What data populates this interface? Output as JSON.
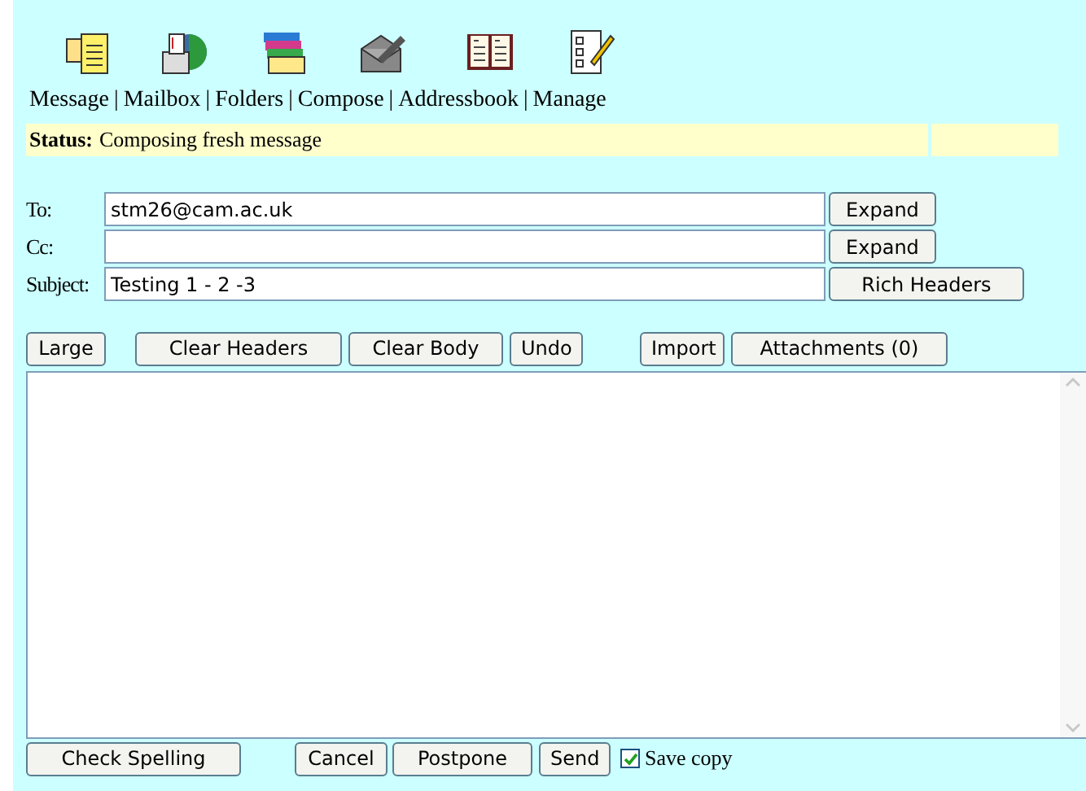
{
  "nav": [
    {
      "label": "Message",
      "kind": "message"
    },
    {
      "label": "Mailbox",
      "kind": "mailbox"
    },
    {
      "label": "Folders",
      "kind": "folders"
    },
    {
      "label": "Compose",
      "kind": "compose"
    },
    {
      "label": "Addressbook",
      "kind": "book"
    },
    {
      "label": "Manage",
      "kind": "checklist"
    }
  ],
  "separators": [
    "|",
    "|",
    "|",
    "|",
    "|"
  ],
  "status": {
    "label": "Status:",
    "text": "Composing fresh message"
  },
  "fields": [
    {
      "label": "To:",
      "value": "stm26@cam.ac.uk",
      "button": "Expand"
    },
    {
      "label": "Cc:",
      "button": "Expand"
    },
    {
      "label": "Subject:",
      "value": "Testing 1 - 2 -3",
      "button": "Rich Headers"
    }
  ],
  "toolbar": [
    "Large",
    "Clear Headers",
    "Clear Body",
    "Undo",
    "Import",
    "Attachments (0)"
  ],
  "bottom_buttons": [
    "Check Spelling",
    "Cancel",
    "Postpone",
    "Send"
  ],
  "save_copy": {
    "label": "Save copy",
    "checked": true
  }
}
